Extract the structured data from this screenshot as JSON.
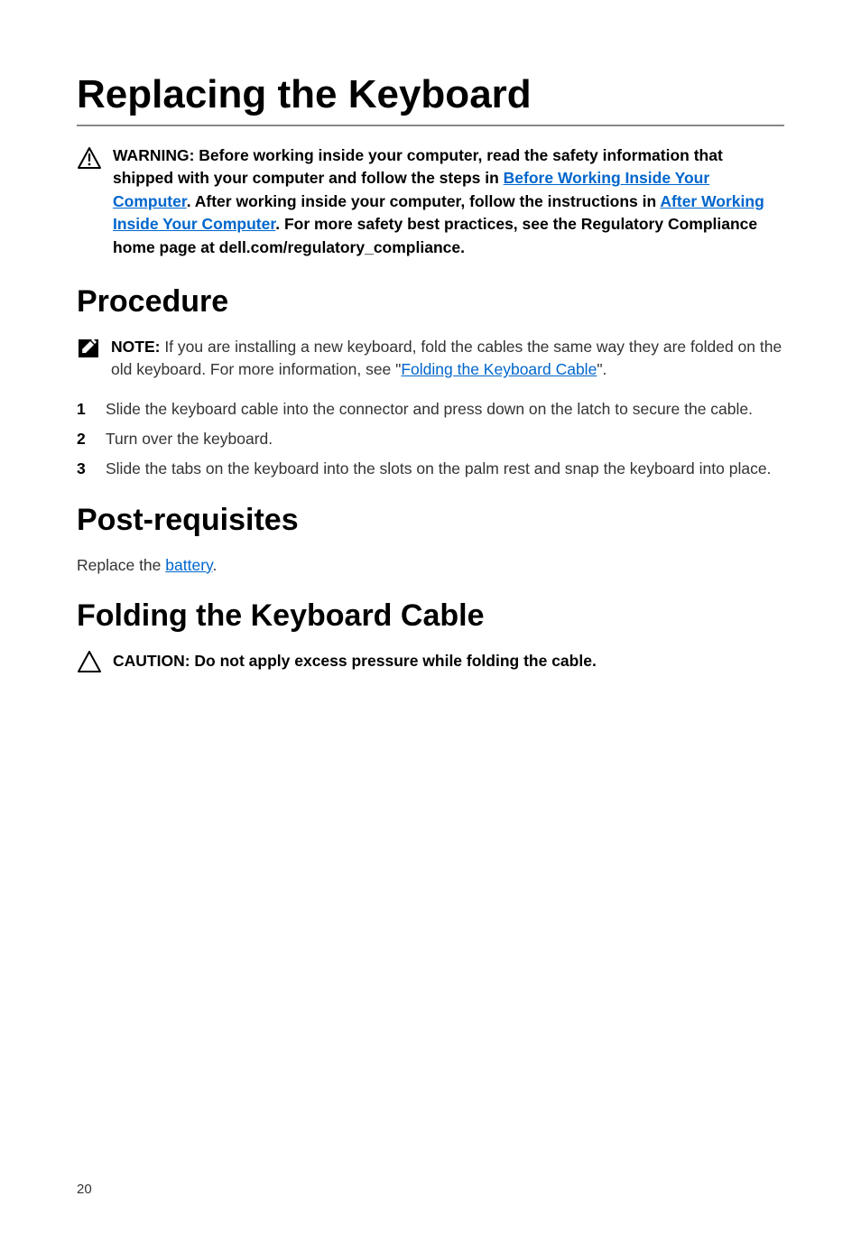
{
  "title": "Replacing the Keyboard",
  "warning": {
    "prefix": "WARNING: Before working inside your computer, read the safety information that shipped with your computer and follow the steps in ",
    "link1": "Before Working Inside Your Computer",
    "mid1": ". After working inside your computer, follow the instructions in ",
    "link2": "After Working Inside Your Computer",
    "suffix": ". For more safety best practices, see the Regulatory Compliance home page at dell.com/regulatory_compliance."
  },
  "procedure": {
    "heading": "Procedure",
    "note": {
      "label": "NOTE: ",
      "text1": "If you are installing a new keyboard, fold the cables the same way they are folded on the old keyboard. For more information, see \"",
      "link": "Folding the Keyboard Cable",
      "text2": "\"."
    },
    "steps": [
      {
        "num": "1",
        "text": "Slide the keyboard cable into the connector and press down on the latch to secure the cable."
      },
      {
        "num": "2",
        "text": "Turn over the keyboard."
      },
      {
        "num": "3",
        "text": "Slide the tabs on the keyboard into the slots on the palm rest and snap the keyboard into place."
      }
    ]
  },
  "postreq": {
    "heading": "Post-requisites",
    "text1": "Replace the ",
    "link": "battery",
    "text2": "."
  },
  "folding": {
    "heading": "Folding the Keyboard Cable",
    "caution": "CAUTION: Do not apply excess pressure while folding the cable."
  },
  "page_number": "20"
}
